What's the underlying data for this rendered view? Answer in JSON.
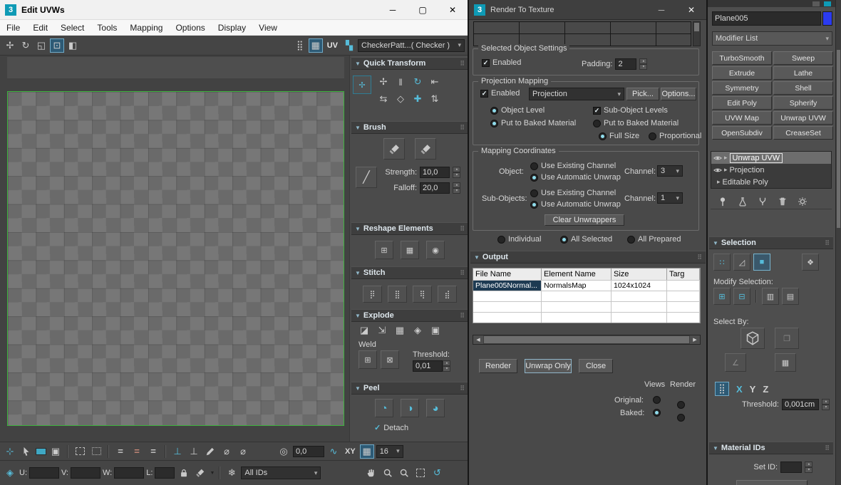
{
  "colors": {
    "accent_teal": "#56bcd9",
    "selection_blue": "#2d5a75",
    "uv_border_green": "#3db33d",
    "wire_swatch_blue": "#2b3bf0"
  },
  "icons": {
    "logo": "3",
    "minimize": "─",
    "maximize": "▢",
    "close": "✕",
    "move": "✢",
    "rotate": "↻",
    "scale": "◱",
    "freeform": "⊡",
    "mirror": "◧",
    "dots_grid": "⣿",
    "show_map": "▦",
    "checker": "▚",
    "qt_move": "✢",
    "qt_align": "‖",
    "qt_rotate": "↻",
    "qt_dock": "⇤",
    "qt_swap": "⇆",
    "qt_pivot": "◇",
    "qt_plus": "✚",
    "qt_distribute": "⇅",
    "line": "╱",
    "reshape_1": "⊞",
    "reshape_2": "▦",
    "reshape_3": "◉",
    "stitch_1": "⡿",
    "stitch_2": "⣿",
    "stitch_3": "⢿",
    "stitch_4": "⣾",
    "explode_1": "◪",
    "explode_2": "⇲",
    "explode_3": "▦",
    "explode_4": "◈",
    "explode_5": "▣",
    "weld": "⊞",
    "weld_target": "⊠",
    "peel_1": "◔",
    "peel_2": "◑",
    "peel_3": "◕",
    "check": "✓",
    "target": "⊹",
    "cube": "▣",
    "equals": "=",
    "magnet": "⊥",
    "diameter": "⌀",
    "abs_typein": "◎",
    "wave": "∿",
    "grid": "▦",
    "gizmo": "◈",
    "caret": "▾",
    "snowflake": "❄",
    "arc_rotate": "↺",
    "vertex_mode": "∷",
    "edge_mode": "◿",
    "poly_mode": "■",
    "element_mode": "❖",
    "grow": "⊞",
    "shrink": "⊟",
    "ring": "▥",
    "loop": "▤",
    "angle": "∠",
    "smoothing": "▦",
    "xyz_grid": "⣿",
    "stack_arrow": "▸",
    "dim_box": "❐"
  },
  "edit_uvws": {
    "title": "Edit UVWs",
    "menu": [
      "File",
      "Edit",
      "Select",
      "Tools",
      "Mapping",
      "Options",
      "Display",
      "View"
    ],
    "toolbar": {
      "uv": "UV",
      "texture_list": "CheckerPatt...( Checker )"
    },
    "quick_transform": {
      "title": "Quick Transform"
    },
    "brush": {
      "title": "Brush",
      "strength_label": "Strength:",
      "strength": "10,0",
      "falloff_label": "Falloff:",
      "falloff": "20,0"
    },
    "reshape": {
      "title": "Reshape Elements"
    },
    "stitch": {
      "title": "Stitch"
    },
    "explode": {
      "title": "Explode",
      "weld_label": "Weld",
      "threshold_label": "Threshold:",
      "threshold": "0,01"
    },
    "peel": {
      "title": "Peel",
      "detach_label": "Detach"
    },
    "status": {
      "coord": "0,0",
      "xy": "XY",
      "grid_size": "16",
      "u": "U:",
      "v": "V:",
      "w": "W:",
      "l": "L:",
      "u_value": "",
      "v_value": "",
      "w_value": "",
      "l_value": "",
      "ids_filter": "All IDs"
    }
  },
  "render_to_texture": {
    "title": "Render To Texture",
    "selected_object_settings": {
      "title": "Selected Object Settings",
      "enabled": "Enabled",
      "padding_label": "Padding:",
      "padding": "2"
    },
    "projection_mapping": {
      "title": "Projection Mapping",
      "enabled": "Enabled",
      "projection": "Projection",
      "pick": "Pick...",
      "options": "Options...",
      "object_level": "Object Level",
      "sub_object_levels": "Sub-Object Levels",
      "put_to_baked_1": "Put to Baked Material",
      "put_to_baked_2": "Put to Baked Material",
      "full_size": "Full Size",
      "proportional": "Proportional"
    },
    "mapping_coordinates": {
      "title": "Mapping Coordinates",
      "object_label": "Object:",
      "sub_objects_label": "Sub-Objects:",
      "use_existing": "Use Existing Channel",
      "use_automatic": "Use Automatic Unwrap",
      "channel_label": "Channel:",
      "object_channel": "3",
      "sub_object_channel": "1",
      "clear_unwrappers": "Clear Unwrappers"
    },
    "scope": {
      "individual": "Individual",
      "all_selected": "All Selected",
      "all_prepared": "All Prepared"
    },
    "output": {
      "title": "Output",
      "columns": [
        "File Name",
        "Element Name",
        "Size",
        "Targ"
      ],
      "row": {
        "file_name": "Plane005Normal...",
        "element_name": "NormalsMap",
        "size": "1024x1024"
      }
    },
    "actions": {
      "render": "Render",
      "unwrap_only": "Unwrap Only",
      "close": "Close"
    },
    "views_render": {
      "views": "Views",
      "render": "Render",
      "original_label": "Original:",
      "baked_label": "Baked:"
    }
  },
  "command_panel": {
    "object_name": "Plane005",
    "modifier_list_label": "Modifier List",
    "modifier_buttons": [
      "TurboSmooth",
      "Sweep",
      "Extrude",
      "Lathe",
      "Symmetry",
      "Shell",
      "Edit Poly",
      "Spherify",
      "UVW Map",
      "Unwrap UVW",
      "OpenSubdiv",
      "CreaseSet"
    ],
    "stack": [
      "Unwrap UVW",
      "Projection",
      "Editable Poly"
    ],
    "selection": {
      "title": "Selection",
      "modify_label": "Modify Selection:",
      "select_by_label": "Select By:",
      "x": "X",
      "y": "Y",
      "z": "Z",
      "threshold_label": "Threshold:",
      "threshold": "0,001cm"
    },
    "material_ids": {
      "title": "Material IDs",
      "set_id_label": "Set ID:"
    }
  }
}
